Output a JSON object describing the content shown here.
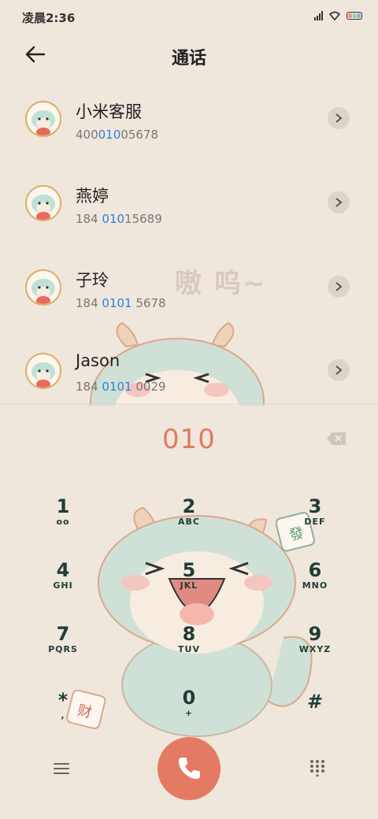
{
  "status": {
    "time": "凌晨2:36"
  },
  "header": {
    "title": "通话"
  },
  "watermark": "嗷 呜~",
  "contacts": [
    {
      "name": "小米客服",
      "num_pre": "400",
      "num_hl": "010",
      "num_post": "05678"
    },
    {
      "name": "燕婷",
      "num_pre": "184 ",
      "num_hl": "010",
      "num_post": "15689"
    },
    {
      "name": "子玲",
      "num_pre": "184 ",
      "num_hl": "0101",
      "num_post": " 5678"
    },
    {
      "name": "Jason",
      "num_pre": "184 ",
      "num_hl": "0101",
      "num_post": " 0029"
    }
  ],
  "dialed": "010",
  "keypad": [
    {
      "digit": "1",
      "letters": "ᴏᴏ"
    },
    {
      "digit": "2",
      "letters": "ABC"
    },
    {
      "digit": "3",
      "letters": "DEF"
    },
    {
      "digit": "4",
      "letters": "GHI"
    },
    {
      "digit": "5",
      "letters": "JKL"
    },
    {
      "digit": "6",
      "letters": "MNO"
    },
    {
      "digit": "7",
      "letters": "PQRS"
    },
    {
      "digit": "8",
      "letters": "TUV"
    },
    {
      "digit": "9",
      "letters": "WXYZ"
    },
    {
      "digit": "*",
      "letters": ","
    },
    {
      "digit": "0",
      "letters": "+"
    },
    {
      "digit": "#",
      "letters": ""
    }
  ],
  "colors": {
    "accent": "#e47a63",
    "highlight": "#2a82d8",
    "background": "#efe6dc"
  }
}
